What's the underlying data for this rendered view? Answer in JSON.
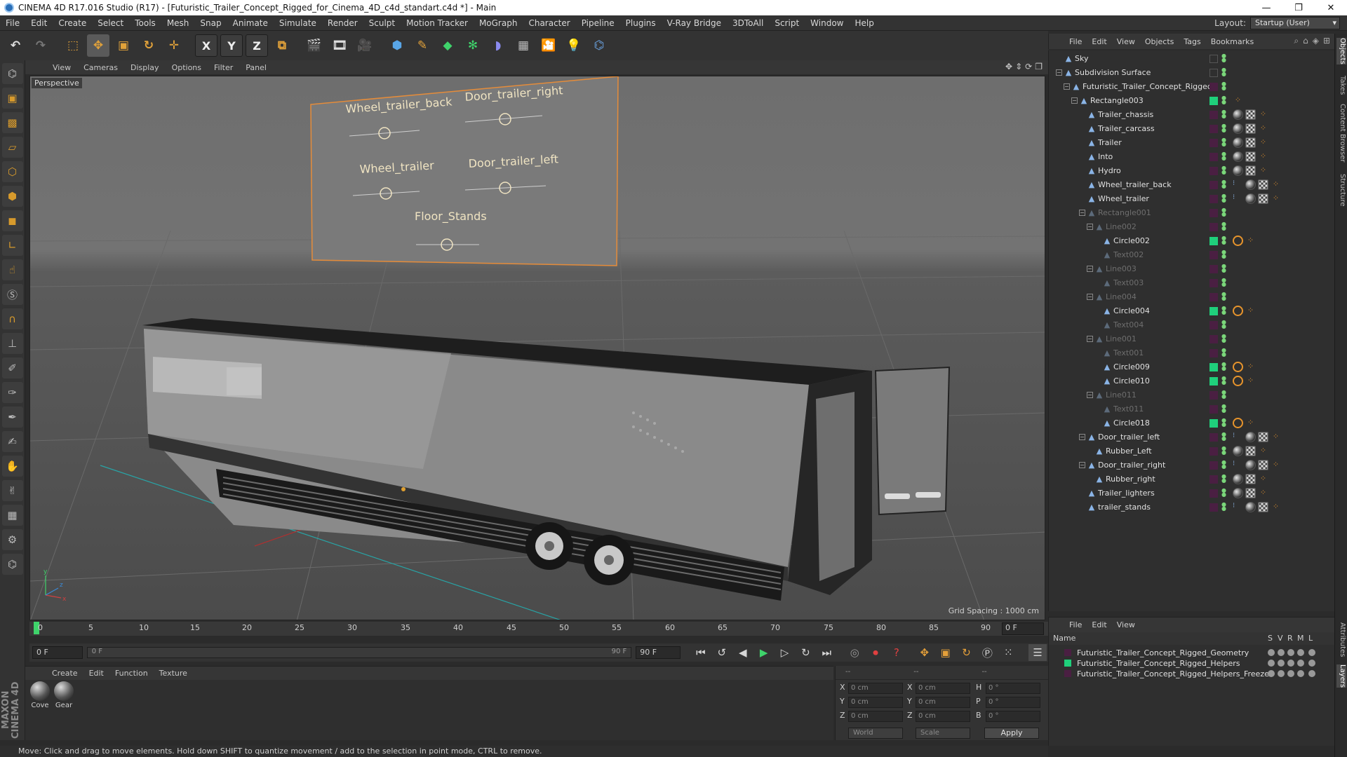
{
  "window": {
    "title": "CINEMA 4D R17.016 Studio (R17) - [Futuristic_Trailer_Concept_Rigged_for_Cinema_4D_c4d_standart.c4d *] - Main",
    "minimize": "—",
    "maximize": "❐",
    "close": "✕"
  },
  "menubar": {
    "items": [
      "File",
      "Edit",
      "Create",
      "Select",
      "Tools",
      "Mesh",
      "Snap",
      "Animate",
      "Simulate",
      "Render",
      "Sculpt",
      "Motion Tracker",
      "MoGraph",
      "Character",
      "Pipeline",
      "Plugins",
      "V-Ray Bridge",
      "3DToAll",
      "Script",
      "Window",
      "Help"
    ],
    "layout_label": "Layout:",
    "layout_value": "Startup (User)"
  },
  "toolbar": {
    "axis_x": "X",
    "axis_y": "Y",
    "axis_z": "Z"
  },
  "viewport": {
    "menu": [
      "View",
      "Cameras",
      "Display",
      "Options",
      "Filter",
      "Panel"
    ],
    "label": "Perspective",
    "grid_spacing": "Grid Spacing : 1000 cm",
    "hud": [
      "Wheel_trailer_back",
      "Door_trailer_right",
      "Wheel_trailer",
      "Door_trailer_left",
      "Floor_Stands"
    ],
    "axes": {
      "x": "x",
      "y": "y",
      "z": "z"
    }
  },
  "timeline": {
    "ticks": [
      "0",
      "5",
      "10",
      "15",
      "20",
      "25",
      "30",
      "35",
      "40",
      "45",
      "50",
      "55",
      "60",
      "65",
      "70",
      "75",
      "80",
      "85",
      "90"
    ],
    "current_frame_field": "0 F",
    "end_field": "0 F",
    "slider_start": "0 F",
    "slider_end": "90 F",
    "max_field": "90 F"
  },
  "materials": {
    "menu": [
      "Create",
      "Edit",
      "Function",
      "Texture"
    ],
    "items": [
      "Cove",
      "Gear"
    ]
  },
  "coordinates": {
    "head": [
      "--",
      "--",
      "--"
    ],
    "rows": [
      {
        "a1": "X",
        "v1": "0 cm",
        "a2": "X",
        "v2": "0 cm",
        "a3": "H",
        "v3": "0 °"
      },
      {
        "a1": "Y",
        "v1": "0 cm",
        "a2": "Y",
        "v2": "0 cm",
        "a3": "P",
        "v3": "0 °"
      },
      {
        "a1": "Z",
        "v1": "0 cm",
        "a2": "Z",
        "v2": "0 cm",
        "a3": "B",
        "v3": "0 °"
      }
    ],
    "space": "World",
    "mode": "Scale",
    "apply": "Apply"
  },
  "status": "Move: Click and drag to move elements. Hold down SHIFT to quantize movement / add to the selection in point mode, CTRL to remove.",
  "object_manager": {
    "menu": [
      "File",
      "Edit",
      "View",
      "Objects",
      "Tags",
      "Bookmarks"
    ],
    "objects": [
      {
        "name": "Sky",
        "depth": 0,
        "dim": false,
        "layer": "none",
        "tags": []
      },
      {
        "name": "Subdivision Surface",
        "depth": 0,
        "dim": false,
        "layer": "none",
        "tags": []
      },
      {
        "name": "Futuristic_Trailer_Concept_Rigged",
        "depth": 1,
        "dim": false,
        "layer": "p",
        "tags": []
      },
      {
        "name": "Rectangle003",
        "depth": 2,
        "dim": false,
        "layer": "g",
        "tags": [
          "ora"
        ]
      },
      {
        "name": "Trailer_chassis",
        "depth": 3,
        "dim": false,
        "layer": "p",
        "tags": [
          "ball",
          "chk",
          "ora"
        ]
      },
      {
        "name": "Trailer_carcass",
        "depth": 3,
        "dim": false,
        "layer": "p",
        "tags": [
          "ball",
          "chk",
          "ora"
        ]
      },
      {
        "name": "Trailer",
        "depth": 3,
        "dim": false,
        "layer": "p",
        "tags": [
          "ball",
          "chk",
          "ora"
        ]
      },
      {
        "name": "Into",
        "depth": 3,
        "dim": false,
        "layer": "p",
        "tags": [
          "ball",
          "chk",
          "ora"
        ]
      },
      {
        "name": "Hydro",
        "depth": 3,
        "dim": false,
        "layer": "p",
        "tags": [
          "ball",
          "chk",
          "ora"
        ]
      },
      {
        "name": "Wheel_trailer_back",
        "depth": 3,
        "dim": false,
        "layer": "p",
        "tags": [
          "dots",
          "ball",
          "chk",
          "ora"
        ]
      },
      {
        "name": "Wheel_trailer",
        "depth": 3,
        "dim": false,
        "layer": "p",
        "tags": [
          "dots",
          "ball",
          "chk",
          "ora"
        ]
      },
      {
        "name": "Rectangle001",
        "depth": 3,
        "dim": true,
        "layer": "p",
        "tags": []
      },
      {
        "name": "Line002",
        "depth": 4,
        "dim": true,
        "layer": "p",
        "tags": []
      },
      {
        "name": "Circle002",
        "depth": 5,
        "dim": false,
        "layer": "g",
        "tags": [
          "no",
          "ora"
        ]
      },
      {
        "name": "Text002",
        "depth": 5,
        "dim": true,
        "layer": "p",
        "tags": []
      },
      {
        "name": "Line003",
        "depth": 4,
        "dim": true,
        "layer": "p",
        "tags": []
      },
      {
        "name": "Text003",
        "depth": 5,
        "dim": true,
        "layer": "p",
        "tags": []
      },
      {
        "name": "Line004",
        "depth": 4,
        "dim": true,
        "layer": "p",
        "tags": []
      },
      {
        "name": "Circle004",
        "depth": 5,
        "dim": false,
        "layer": "g",
        "tags": [
          "no",
          "ora"
        ]
      },
      {
        "name": "Text004",
        "depth": 5,
        "dim": true,
        "layer": "p",
        "tags": []
      },
      {
        "name": "Line001",
        "depth": 4,
        "dim": true,
        "layer": "p",
        "tags": []
      },
      {
        "name": "Text001",
        "depth": 5,
        "dim": true,
        "layer": "p",
        "tags": []
      },
      {
        "name": "Circle009",
        "depth": 5,
        "dim": false,
        "layer": "g",
        "tags": [
          "no",
          "ora"
        ]
      },
      {
        "name": "Circle010",
        "depth": 5,
        "dim": false,
        "layer": "g",
        "tags": [
          "no",
          "ora"
        ]
      },
      {
        "name": "Line011",
        "depth": 4,
        "dim": true,
        "layer": "p",
        "tags": []
      },
      {
        "name": "Text011",
        "depth": 5,
        "dim": true,
        "layer": "p",
        "tags": []
      },
      {
        "name": "Circle018",
        "depth": 5,
        "dim": false,
        "layer": "g",
        "tags": [
          "no",
          "ora"
        ]
      },
      {
        "name": "Door_trailer_left",
        "depth": 3,
        "dim": false,
        "layer": "p",
        "tags": [
          "dots",
          "ball",
          "chk",
          "ora"
        ]
      },
      {
        "name": "Rubber_Left",
        "depth": 4,
        "dim": false,
        "layer": "p",
        "tags": [
          "ball",
          "chk",
          "ora"
        ]
      },
      {
        "name": "Door_trailer_right",
        "depth": 3,
        "dim": false,
        "layer": "p",
        "tags": [
          "dots",
          "ball",
          "chk",
          "ora"
        ]
      },
      {
        "name": "Rubber_right",
        "depth": 4,
        "dim": false,
        "layer": "p",
        "tags": [
          "ball",
          "chk",
          "ora"
        ]
      },
      {
        "name": "Trailer_lighters",
        "depth": 3,
        "dim": false,
        "layer": "p",
        "tags": [
          "ball",
          "chk",
          "ora"
        ]
      },
      {
        "name": "trailer_stands",
        "depth": 3,
        "dim": false,
        "layer": "p",
        "tags": [
          "dots",
          "ball",
          "chk",
          "ora"
        ]
      }
    ]
  },
  "layers": {
    "menu": [
      "File",
      "Edit",
      "View"
    ],
    "header": {
      "name": "Name",
      "cols": [
        "S",
        "V",
        "R",
        "M",
        "L"
      ]
    },
    "items": [
      {
        "name": "Futuristic_Trailer_Concept_Rigged_Geometry",
        "color": "#4a1f42"
      },
      {
        "name": "Futuristic_Trailer_Concept_Rigged_Helpers",
        "color": "#1fd07b"
      },
      {
        "name": "Futuristic_Trailer_Concept_Rigged_Helpers_Freeze",
        "color": "#4a1f42"
      }
    ]
  },
  "vtabs": [
    "Objects",
    "Takes",
    "Content Browser",
    "Structure",
    "Attributes",
    "Layers"
  ],
  "brand": "MAXON CINEMA 4D"
}
